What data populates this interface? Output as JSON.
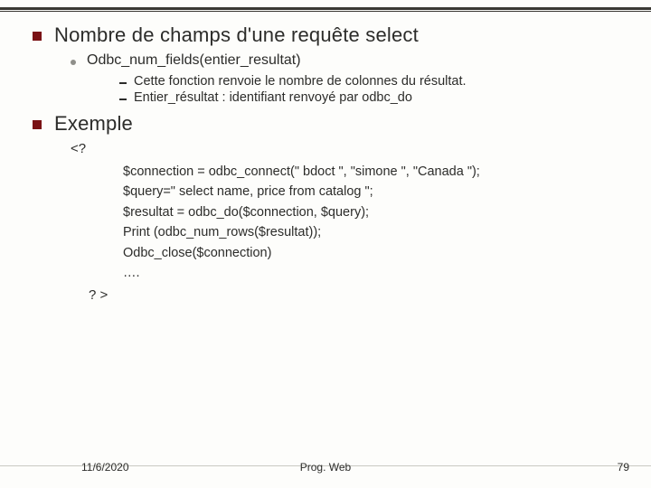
{
  "sections": {
    "s1": {
      "title": "Nombre de champs d'une requête select",
      "item": "Odbc_num_fields(entier_resultat)",
      "sub1": "Cette fonction renvoie le nombre de colonnes du résultat.",
      "sub2": "Entier_résultat : identifiant renvoyé par odbc_do"
    },
    "s2": {
      "title": "Exemple",
      "open": "<?",
      "code": {
        "l1": "$connection = odbc_connect(\" bdoct \", \"simone \", \"Canada \");",
        "l2": "$query=\" select name, price from catalog \";",
        "l3": "$resultat = odbc_do($connection, $query);",
        "l4": "Print (odbc_num_rows($resultat));",
        "l5": "Odbc_close($connection)",
        "l6": "…."
      },
      "close": "? >"
    }
  },
  "footer": {
    "date": "11/6/2020",
    "center": "Prog. Web",
    "page": "79"
  }
}
